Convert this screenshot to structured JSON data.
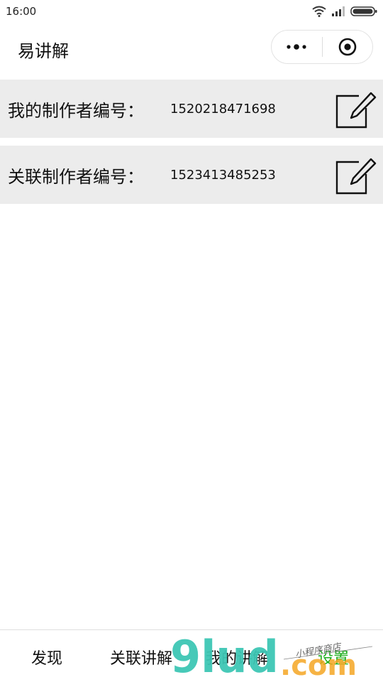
{
  "status_bar": {
    "time": "16:00",
    "icons": [
      "wifi-icon",
      "signal-icon",
      "battery-icon"
    ]
  },
  "nav": {
    "title": "易讲解",
    "capsule_icons": [
      "more-dots-icon",
      "close-target-icon"
    ]
  },
  "rows": [
    {
      "label": "我的制作者编号：",
      "value": "1520218471698",
      "icon": "edit-icon"
    },
    {
      "label": "关联制作者编号：",
      "value": "1523413485253",
      "icon": "edit-icon"
    }
  ],
  "tabs": [
    {
      "label": "发现"
    },
    {
      "label": "关联讲解"
    },
    {
      "label": "我的讲解"
    },
    {
      "label": "设置",
      "active": true
    }
  ],
  "watermark": {
    "brand": "9lud",
    "suffix": ".com",
    "tagline": "小程序商店"
  },
  "colors": {
    "row_background": "#ececec",
    "tab_active": "#1aad19",
    "watermark_teal": "#3dc6b4",
    "watermark_orange": "#f5a623"
  }
}
